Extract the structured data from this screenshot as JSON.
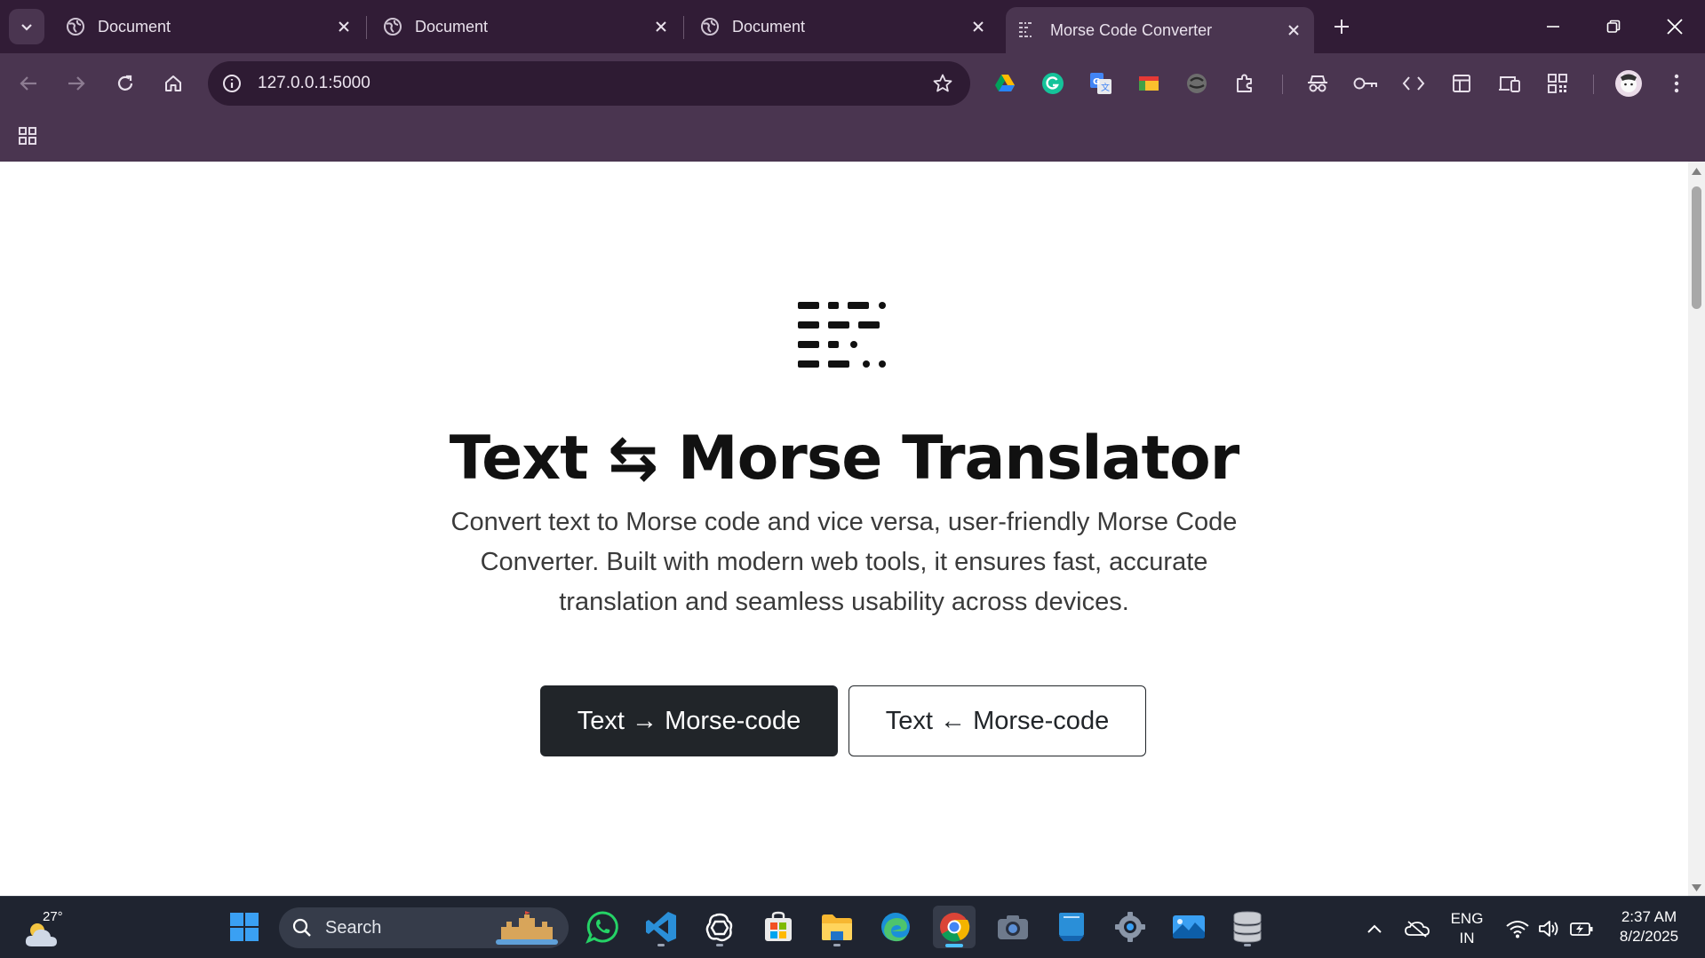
{
  "browser": {
    "tabs": [
      {
        "title": "Document",
        "active": false
      },
      {
        "title": "Document",
        "active": false
      },
      {
        "title": "Document",
        "active": false
      },
      {
        "title": "Morse Code Converter",
        "active": true
      }
    ],
    "address": "127.0.0.1:5000",
    "extensions": [
      "google-drive-icon",
      "grammarly-icon",
      "google-translate-icon",
      "chromecast-icon",
      "vpn-icon",
      "extensions-puzzle-icon",
      "incognito-icon",
      "password-key-icon",
      "devtools-code-icon",
      "tab-layout-icon",
      "device-mode-icon",
      "qr-code-icon",
      "profile-avatar"
    ]
  },
  "page": {
    "title": "Text ⇆ Morse Translator",
    "description": "Convert text to Morse code and vice versa, user-friendly Morse Code Converter. Built with modern web tools, it ensures fast, accurate translation and seamless usability across devices.",
    "buttons": {
      "encode": "Text → Morse-code",
      "decode": "Text ← Morse-code"
    },
    "colors": {
      "primary": "#212529",
      "chrome": "#4a3550",
      "tabbar": "#311c36"
    }
  },
  "taskbar": {
    "weather_temp": "27°",
    "search_placeholder": "Search",
    "apps": [
      "windows-start-icon",
      "whatsapp-icon",
      "vscode-icon",
      "chatgpt-icon",
      "microsoft-store-icon",
      "file-explorer-icon",
      "edge-icon",
      "chrome-icon",
      "camera-icon",
      "notes-icon",
      "settings-icon",
      "photos-icon",
      "database-icon"
    ],
    "lang_top": "ENG",
    "lang_bottom": "IN",
    "time": "2:37 AM",
    "date": "8/2/2025"
  }
}
